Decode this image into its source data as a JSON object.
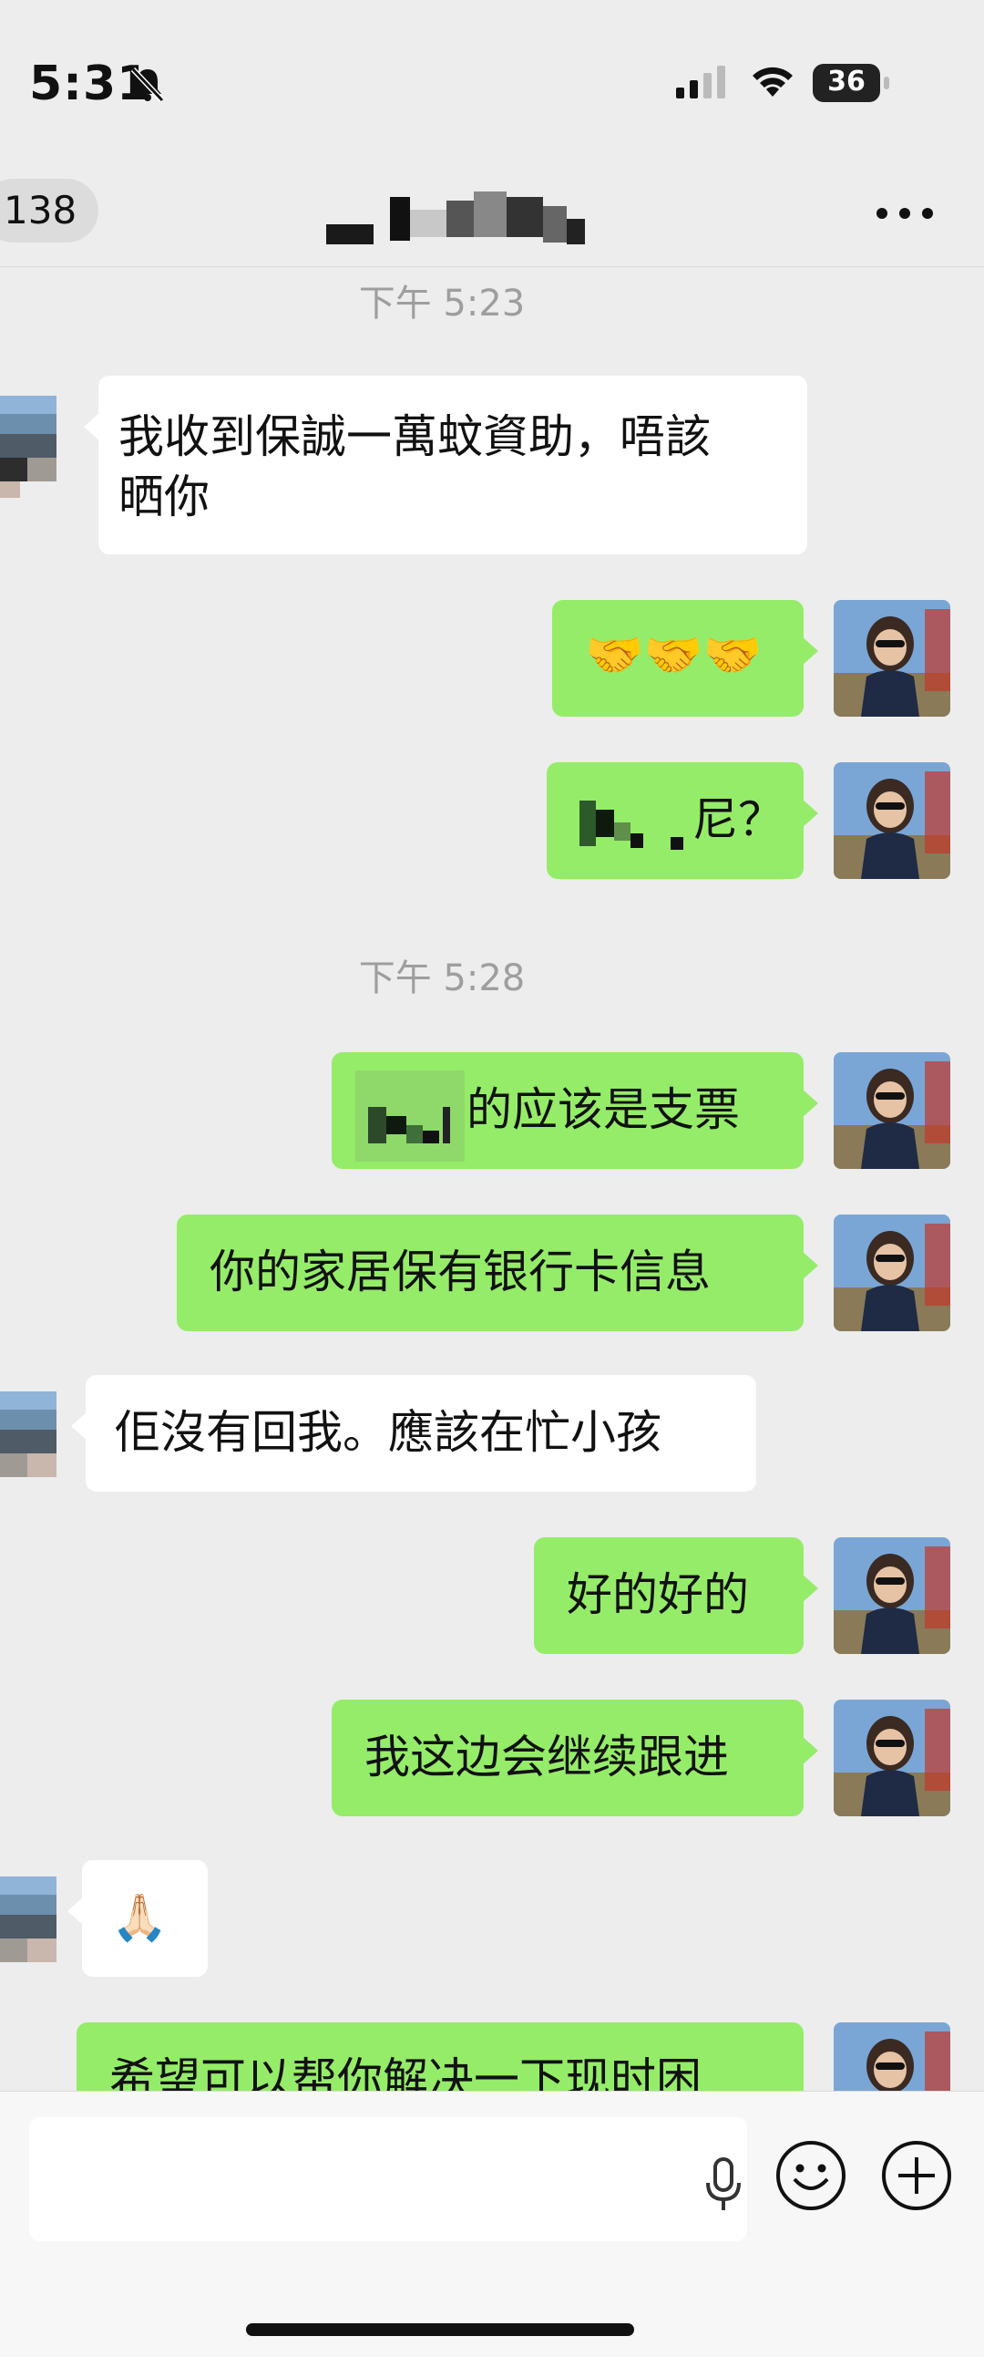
{
  "status_bar": {
    "time": "5:31",
    "battery": "36"
  },
  "nav": {
    "back_count": "138"
  },
  "timestamps": [
    "下午 5:23",
    "下午 5:28"
  ],
  "messages": [
    {
      "side": "in",
      "text": "我收到保誠一萬蚊資助，唔該\n晒你"
    },
    {
      "side": "out",
      "text": "🤝🤝🤝"
    },
    {
      "side": "out",
      "text": "尼？"
    },
    {
      "side": "out",
      "text": "的应该是支票"
    },
    {
      "side": "out",
      "text": "你的家居保有银行卡信息"
    },
    {
      "side": "in",
      "text": "佢沒有回我。應該在忙小孩"
    },
    {
      "side": "out",
      "text": "好的好的"
    },
    {
      "side": "out",
      "text": "我这边会继续跟进"
    },
    {
      "side": "in",
      "text": "🙏🏻"
    },
    {
      "side": "out",
      "text": "希望可以帮你解决一下现时困"
    }
  ],
  "input": {
    "placeholder": ""
  },
  "colors": {
    "background": "#ededed",
    "bubble_out": "#95ec69",
    "bubble_in": "#ffffff",
    "timestamp": "#9e9e9e"
  },
  "icons": [
    "bell-slash-icon",
    "signal-icon",
    "wifi-icon",
    "battery-icon",
    "more-icon",
    "microphone-icon",
    "emoji-icon",
    "plus-icon"
  ]
}
